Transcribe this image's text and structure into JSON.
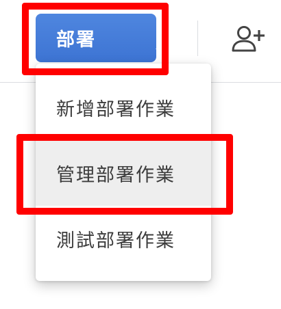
{
  "toolbar": {
    "deploy_button_label": "部署",
    "add_user_icon": "person-add-icon"
  },
  "menu": {
    "items": [
      {
        "label": "新增部署作業"
      },
      {
        "label": "管理部署作業"
      },
      {
        "label": "測試部署作業"
      }
    ]
  },
  "colors": {
    "button_bg": "#4a80dc",
    "highlight": "#ff0000",
    "menu_hover_bg": "#eeeeee",
    "text": "#3c3c3c"
  }
}
